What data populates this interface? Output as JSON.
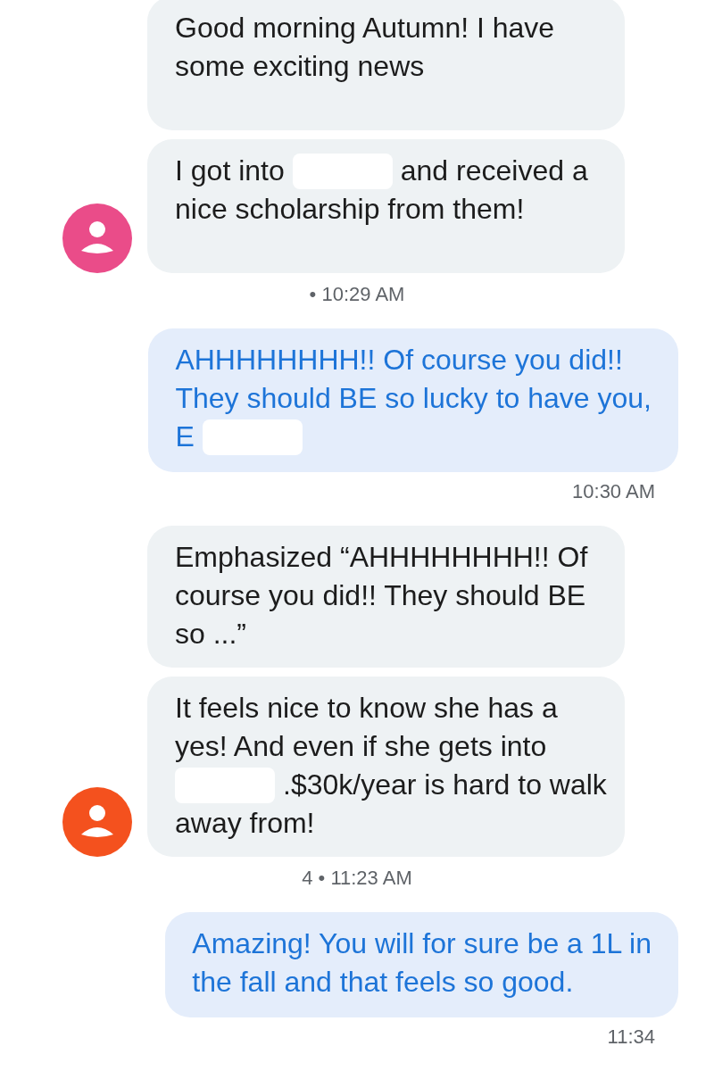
{
  "groups": [
    {
      "kind": "incoming",
      "color": "#ea4c89",
      "time": "• 10:29 AM",
      "bubbles": [
        {
          "lines": [
            [
              {
                "kind": "text",
                "text": "Good morning Autumn! I have"
              }
            ],
            [
              {
                "kind": "text",
                "text": "some exciting news"
              }
            ]
          ]
        },
        {
          "lines": [
            [
              {
                "kind": "text",
                "text": "I got into"
              },
              {
                "kind": "redacted"
              },
              {
                "kind": "text",
                "text": "and received a"
              }
            ],
            [
              {
                "kind": "text",
                "text": "nice scholarship from them!"
              }
            ]
          ]
        }
      ]
    },
    {
      "kind": "outgoing",
      "time": "10:30 AM",
      "bubbles": [
        {
          "lines": [
            [
              {
                "kind": "text",
                "text": "AHHHHHHHH!! Of course you did!!"
              }
            ],
            [
              {
                "kind": "text",
                "text": "They should BE so lucky to have you,"
              }
            ],
            [
              {
                "kind": "text",
                "text": "E"
              },
              {
                "kind": "redacted"
              }
            ]
          ]
        }
      ]
    },
    {
      "kind": "incoming",
      "color": "#f4511e",
      "time": "4 • 11:23 AM",
      "bubbles": [
        {
          "lines": [
            [
              {
                "kind": "text",
                "text": "Emphasized “AHHHHHHHH!! Of"
              }
            ],
            [
              {
                "kind": "text",
                "text": "course you did!! They should BE"
              }
            ],
            [
              {
                "kind": "text",
                "text": "so ...”"
              }
            ]
          ]
        },
        {
          "lines": [
            [
              {
                "kind": "text",
                "text": "It feels nice to know she has a"
              }
            ],
            [
              {
                "kind": "text",
                "text": "yes! And even if she gets into"
              }
            ],
            [
              {
                "kind": "redacted"
              },
              {
                "kind": "text",
                "text": ".$30k/year is hard to walk"
              }
            ],
            [
              {
                "kind": "text",
                "text": "away from!"
              }
            ]
          ]
        }
      ]
    },
    {
      "kind": "outgoing",
      "time": "11:34",
      "bubbles": [
        {
          "lines": [
            [
              {
                "kind": "text",
                "text": "Amazing! You will for sure be a 1L in"
              }
            ],
            [
              {
                "kind": "text",
                "text": "the fall and that feels so good."
              }
            ]
          ]
        }
      ]
    }
  ]
}
